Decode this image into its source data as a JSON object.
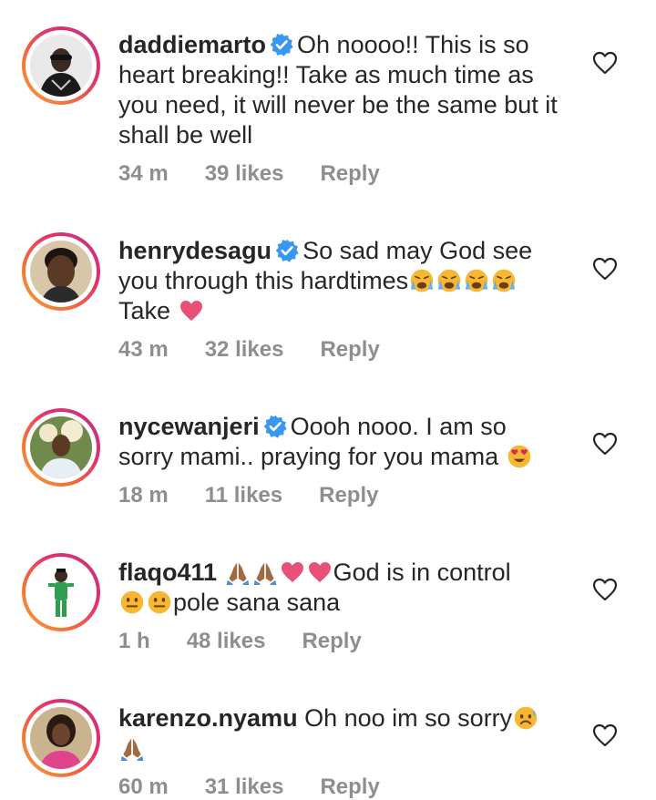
{
  "comments": [
    {
      "username": "daddiemarto",
      "verified": true,
      "text": "Oh noooo!! This is so heart breaking!! Take as much time as you need, it will never be the same but it shall be well",
      "time": "34 m",
      "likes": "39 likes",
      "reply": "Reply"
    },
    {
      "username": "henrydesagu",
      "verified": true,
      "text": "So sad may God see you through this hardtimes",
      "text_after": "Take",
      "time": "43 m",
      "likes": "32 likes",
      "reply": "Reply"
    },
    {
      "username": "nycewanjeri",
      "verified": true,
      "text": "Oooh nooo.  I am so sorry mami.. praying for you mama",
      "time": "18 m",
      "likes": "11 likes",
      "reply": "Reply"
    },
    {
      "username": "flaqo411",
      "verified": false,
      "text": "God is in control",
      "text_after": "pole sana sana",
      "time": "1 h",
      "likes": "48 likes",
      "reply": "Reply"
    },
    {
      "username": "karenzo.nyamu",
      "verified": false,
      "text": "Oh noo im so sorry",
      "time": "60 m",
      "likes": "31 likes",
      "reply": "Reply"
    }
  ],
  "colors": {
    "text": "#262626",
    "meta": "#8e8e8e",
    "verified": "#3897f0",
    "heart_emoji": "#e8507a"
  },
  "icons": {
    "verified": "verified-badge-icon",
    "like": "heart-outline-icon"
  }
}
